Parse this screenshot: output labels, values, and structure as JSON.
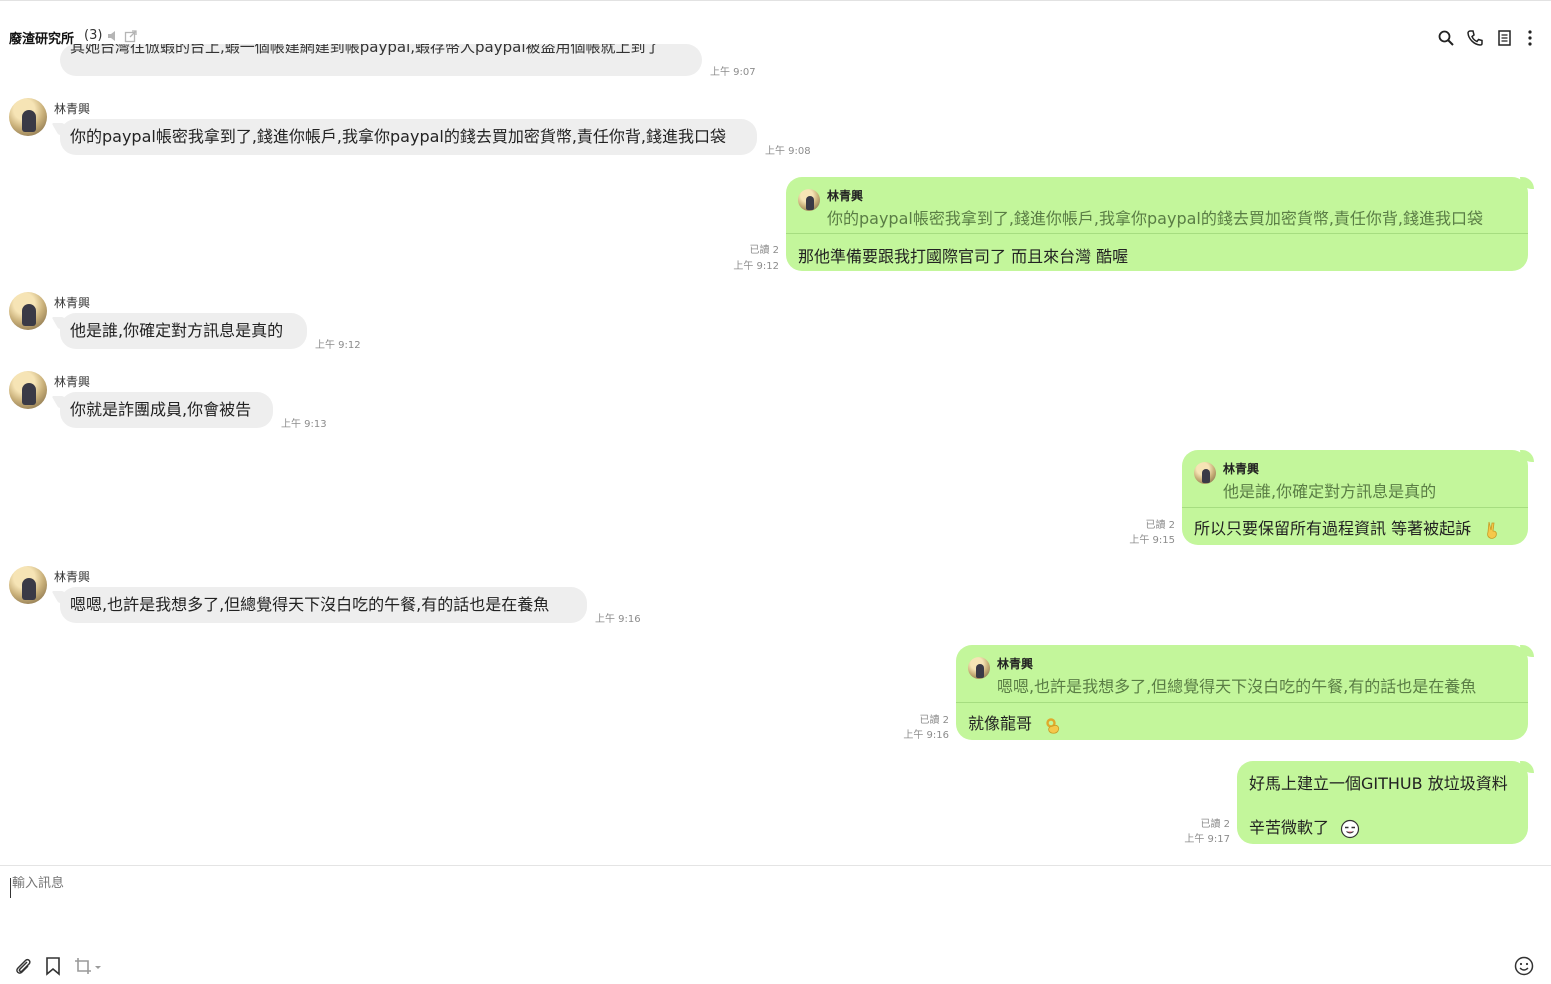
{
  "header": {
    "title": "廢渣研究所",
    "member_count": "(3)"
  },
  "partial_message": {
    "text": "其她台灣往倣蝦的台上,蝦一個帳建網建到帳paypal,蝦存幣人paypal被盜用個帳就上到了",
    "time": "上午 9:07"
  },
  "messages": [
    {
      "sender": "林青興",
      "text": "你的paypal帳密我拿到了,錢進你帳戶,我拿你paypal的錢去買加密貨幣,責任你背,錢進我口袋",
      "time": "上午 9:08"
    },
    {
      "read": "已讀 2",
      "time": "上午 9:12",
      "reply_name": "林青興",
      "reply_text": "你的paypal帳密我拿到了,錢進你帳戶,我拿你paypal的錢去買加密貨幣,責任你背,錢進我口袋",
      "text": "那他準備要跟我打國際官司了 而且來台灣 酷喔"
    },
    {
      "sender": "林青興",
      "text": "他是誰,你確定對方訊息是真的",
      "time": "上午 9:12"
    },
    {
      "sender": "林青興",
      "text": "你就是詐團成員,你會被告",
      "time": "上午 9:13"
    },
    {
      "read": "已讀 2",
      "time": "上午 9:15",
      "reply_name": "林青興",
      "reply_text": "他是誰,你確定對方訊息是真的",
      "text": "所以只要保留所有過程資訊 等著被起訴",
      "emoji": "victory-hand"
    },
    {
      "sender": "林青興",
      "text": "嗯嗯,也許是我想多了,但總覺得天下沒白吃的午餐,有的話也是在養魚",
      "time": "上午 9:16"
    },
    {
      "read": "已讀 2",
      "time": "上午 9:16",
      "reply_name": "林青興",
      "reply_text": "嗯嗯,也許是我想多了,但總覺得天下沒白吃的午餐,有的話也是在養魚",
      "text": "就像龍哥",
      "emoji": "ok-hand"
    },
    {
      "read": "已讀 2",
      "time": "上午 9:17",
      "line1": "好馬上建立一個GITHUB 放垃圾資料",
      "line2": "辛苦微軟了",
      "emoji": "smirk-face"
    }
  ],
  "composer": {
    "placeholder": "輸入訊息"
  },
  "colors": {
    "outgoing_bubble": "#c3f69b",
    "incoming_bubble": "#eeeeee"
  }
}
